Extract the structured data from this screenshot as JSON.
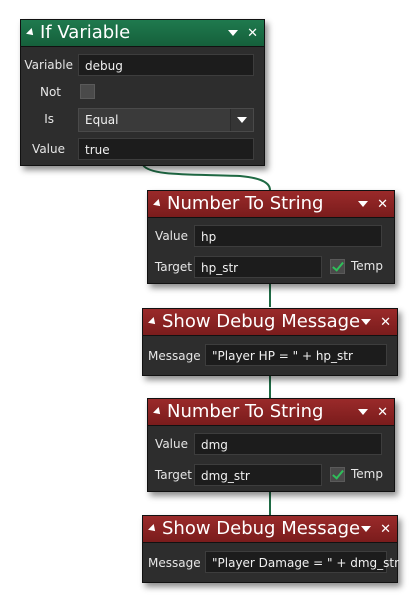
{
  "nodes": {
    "if_variable": {
      "title": "If Variable",
      "variable_label": "Variable",
      "variable_value": "debug",
      "not_label": "Not",
      "not_checked": false,
      "is_label": "Is",
      "is_value": "Equal",
      "value_label": "Value",
      "value_value": "true",
      "color": "#1a6e45"
    },
    "number_to_string_1": {
      "title": "Number To String",
      "value_label": "Value",
      "value_value": "hp",
      "target_label": "Target",
      "target_value": "hp_str",
      "temp_label": "Temp",
      "temp_checked": true,
      "color": "#8a2424"
    },
    "show_debug_1": {
      "title": "Show Debug Message",
      "message_label": "Message",
      "message_value": "\"Player HP = \" + hp_str",
      "color": "#8a2424"
    },
    "number_to_string_2": {
      "title": "Number To String",
      "value_label": "Value",
      "value_value": "dmg",
      "target_label": "Target",
      "target_value": "dmg_str",
      "temp_label": "Temp",
      "temp_checked": true,
      "color": "#8a2424"
    },
    "show_debug_2": {
      "title": "Show Debug Message",
      "message_label": "Message",
      "message_value": "\"Player Damage = \" + dmg_str",
      "color": "#8a2424"
    }
  },
  "icons": [
    "collapse-icon",
    "dropdown-icon",
    "close-icon",
    "checkmark-icon"
  ]
}
